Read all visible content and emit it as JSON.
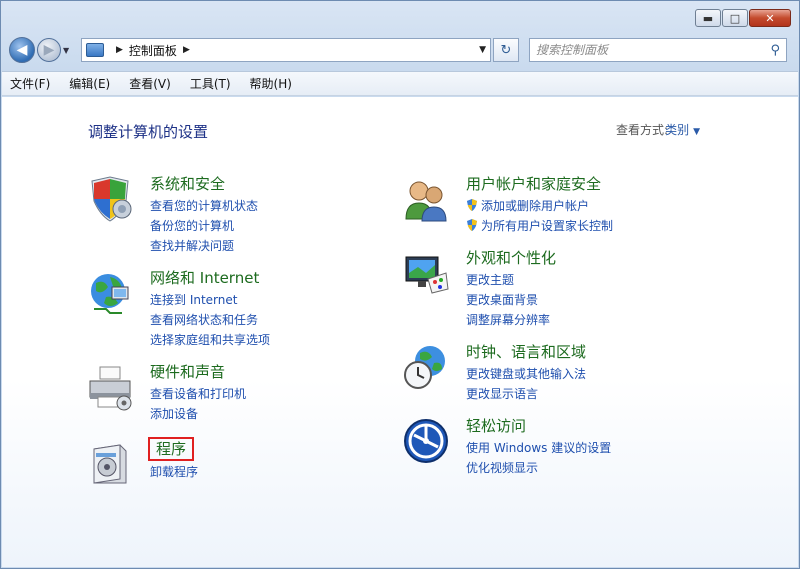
{
  "window": {
    "caption": {
      "minimize": "▬",
      "maximize": "□",
      "close": "✕"
    }
  },
  "address": {
    "path": [
      "控制面板"
    ],
    "search_placeholder": "搜索控制面板"
  },
  "menu": [
    "文件(F)",
    "编辑(E)",
    "查看(V)",
    "工具(T)",
    "帮助(H)"
  ],
  "page": {
    "title": "调整计算机的设置",
    "view_by_label": "查看方式:",
    "view_by_value": "类别"
  },
  "categories": {
    "security": {
      "icon": "shield-icon",
      "title": "系统和安全",
      "links": [
        "查看您的计算机状态",
        "备份您的计算机",
        "查找并解决问题"
      ]
    },
    "network": {
      "icon": "network-globe-icon",
      "title": "网络和 Internet",
      "links": [
        "连接到 Internet",
        "查看网络状态和任务",
        "选择家庭组和共享选项"
      ]
    },
    "hardware": {
      "icon": "printer-icon",
      "title": "硬件和声音",
      "links": [
        "查看设备和打印机",
        "添加设备"
      ]
    },
    "programs": {
      "icon": "programs-box-icon",
      "title": "程序",
      "links": [
        "卸载程序"
      ]
    },
    "users": {
      "icon": "users-icon",
      "title": "用户帐户和家庭安全",
      "links": [
        "添加或删除用户帐户",
        "为所有用户设置家长控制"
      ]
    },
    "appearance": {
      "icon": "monitor-palette-icon",
      "title": "外观和个性化",
      "links": [
        "更改主题",
        "更改桌面背景",
        "调整屏幕分辨率"
      ]
    },
    "clock": {
      "icon": "clock-globe-icon",
      "title": "时钟、语言和区域",
      "links": [
        "更改键盘或其他输入法",
        "更改显示语言"
      ]
    },
    "ease": {
      "icon": "ease-of-access-icon",
      "title": "轻松访问",
      "links": [
        "使用 Windows 建议的设置",
        "优化视频显示"
      ]
    }
  },
  "colors": {
    "category_title": "#1d6b1f",
    "link": "#1f4fae",
    "highlight_box": "#e02020"
  }
}
